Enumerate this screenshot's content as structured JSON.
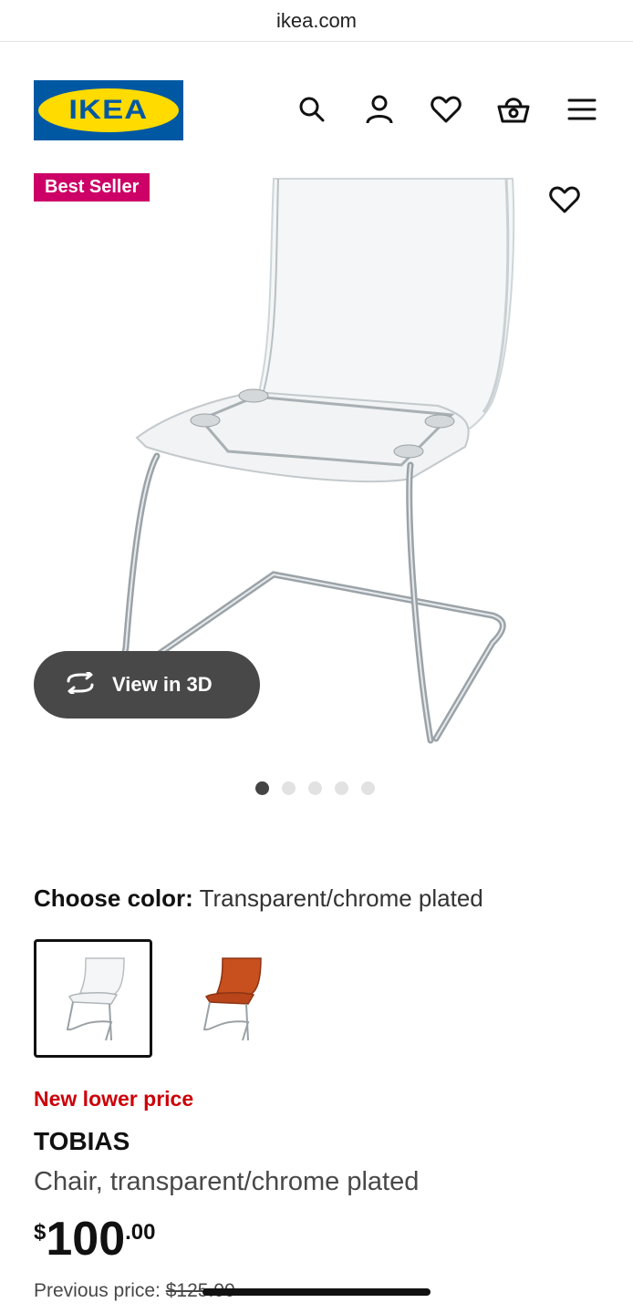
{
  "browser": {
    "url": "ikea.com"
  },
  "header": {
    "logo_text": "IKEA",
    "icons": [
      "search-icon",
      "account-icon",
      "heart-icon",
      "basket-icon",
      "menu-icon"
    ]
  },
  "product_media": {
    "badge": "Best Seller",
    "view_3d_label": "View in 3D",
    "image_count": 5,
    "active_image": 1
  },
  "color_selector": {
    "label": "Choose color:",
    "selected_value": "Transparent/chrome plated"
  },
  "product": {
    "promo": "New lower price",
    "name": "TOBIAS",
    "description": "Chair, transparent/chrome plated",
    "price_currency": "$",
    "price_integer": "100",
    "price_decimal": ".00",
    "previous_price_label": "Previous price: ",
    "previous_price_value": "$125.00"
  },
  "colors": {
    "brand_blue": "#0058a3",
    "brand_yellow": "#ffdb00",
    "badge": "#cc0066",
    "promo_red": "#cc0008"
  }
}
